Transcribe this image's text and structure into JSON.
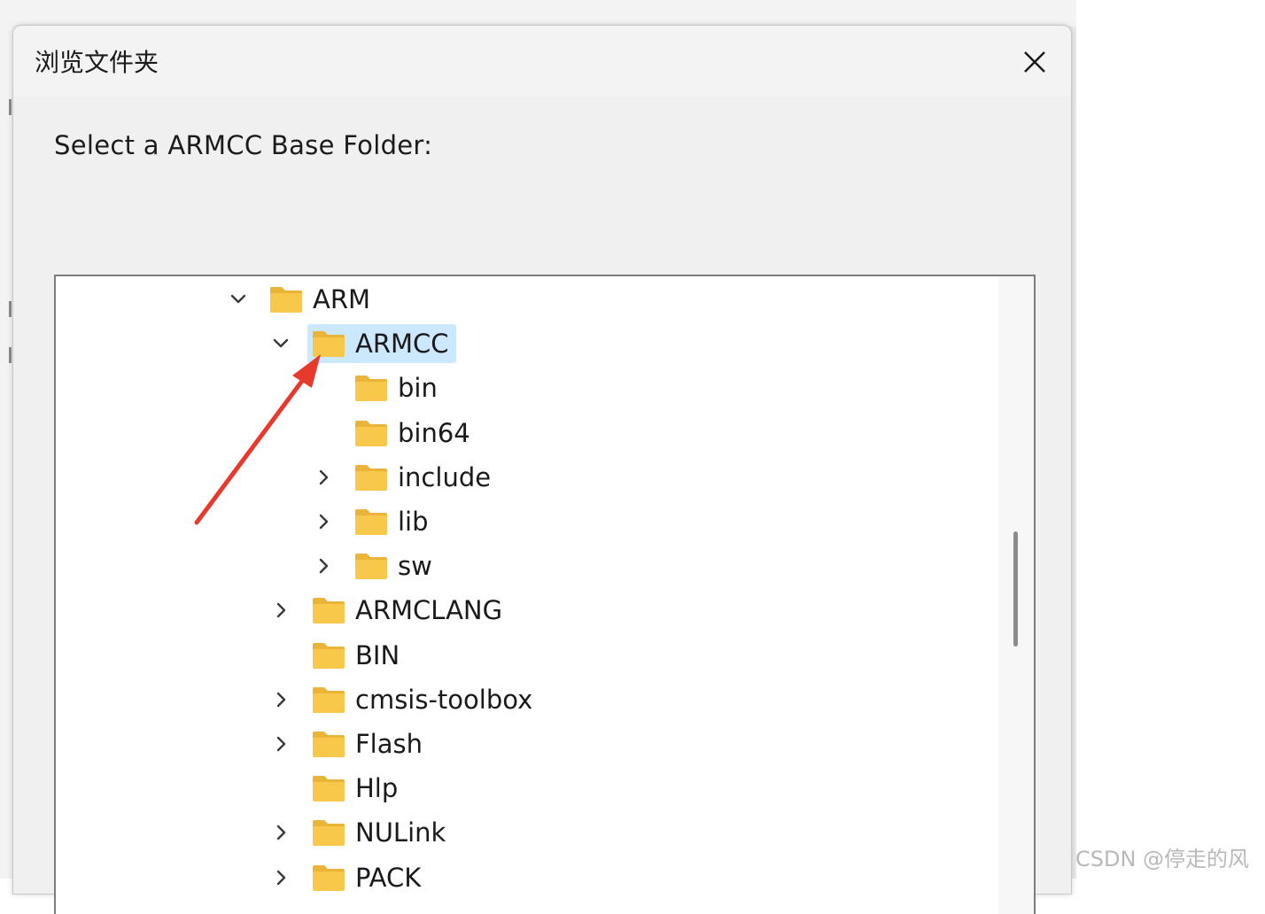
{
  "dialog": {
    "title": "浏览文件夹",
    "prompt": "Select a ARMCC Base Folder:"
  },
  "tree": {
    "items": [
      {
        "label": "ARM",
        "level": 0,
        "expander": "expanded",
        "selected": false
      },
      {
        "label": "ARMCC",
        "level": 1,
        "expander": "expanded",
        "selected": true
      },
      {
        "label": "bin",
        "level": 2,
        "expander": "none",
        "selected": false
      },
      {
        "label": "bin64",
        "level": 2,
        "expander": "none",
        "selected": false
      },
      {
        "label": "include",
        "level": 2,
        "expander": "collapsed",
        "selected": false
      },
      {
        "label": "lib",
        "level": 2,
        "expander": "collapsed",
        "selected": false
      },
      {
        "label": "sw",
        "level": 2,
        "expander": "collapsed",
        "selected": false
      },
      {
        "label": "ARMCLANG",
        "level": 1,
        "expander": "collapsed",
        "selected": false
      },
      {
        "label": "BIN",
        "level": 1,
        "expander": "none",
        "selected": false
      },
      {
        "label": "cmsis-toolbox",
        "level": 1,
        "expander": "collapsed",
        "selected": false
      },
      {
        "label": "Flash",
        "level": 1,
        "expander": "collapsed",
        "selected": false
      },
      {
        "label": "Hlp",
        "level": 1,
        "expander": "none",
        "selected": false
      },
      {
        "label": "NULink",
        "level": 1,
        "expander": "collapsed",
        "selected": false
      },
      {
        "label": "PACK",
        "level": 1,
        "expander": "collapsed",
        "selected": false
      }
    ]
  },
  "icons": {
    "close": "close-icon",
    "folder": "folder-icon",
    "expanded": "chevron-down-icon",
    "collapsed": "chevron-right-icon"
  },
  "colors": {
    "selection": "#cce8ff",
    "folder_body": "#f8c84a",
    "folder_tab": "#e9b437",
    "annotation_arrow": "#e8392d"
  },
  "watermark": "CSDN @停走的风"
}
